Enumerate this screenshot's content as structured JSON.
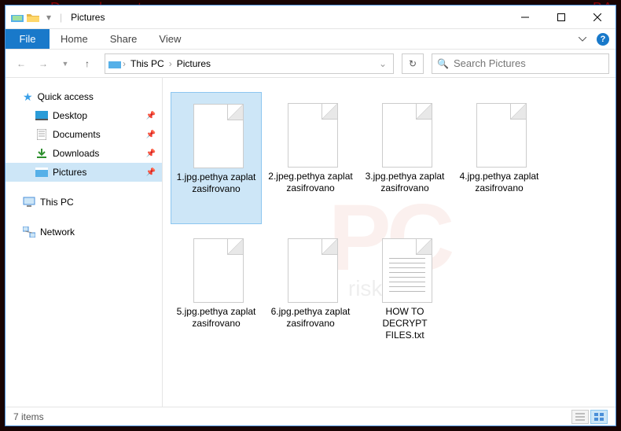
{
  "titlebar": {
    "title": "Pictures"
  },
  "ribbon": {
    "file": "File",
    "home": "Home",
    "share": "Share",
    "view": "View"
  },
  "breadcrumb": {
    "thispc": "This PC",
    "pictures": "Pictures"
  },
  "search": {
    "placeholder": "Search Pictures"
  },
  "sidebar": {
    "quickaccess": "Quick access",
    "desktop": "Desktop",
    "documents": "Documents",
    "downloads": "Downloads",
    "pictures": "Pictures",
    "thispc": "This PC",
    "network": "Network"
  },
  "files": [
    {
      "name": "1.jpg.pethya zaplat zasifrovano",
      "type": "blank",
      "sel": true
    },
    {
      "name": "2.jpeg.pethya zaplat zasifrovano",
      "type": "blank",
      "sel": false
    },
    {
      "name": "3.jpg.pethya zaplat zasifrovano",
      "type": "blank",
      "sel": false
    },
    {
      "name": "4.jpg.pethya zaplat zasifrovano",
      "type": "blank",
      "sel": false
    },
    {
      "name": "5.jpg.pethya zaplat zasifrovano",
      "type": "blank",
      "sel": false
    },
    {
      "name": "6.jpg.pethya zaplat zasifrovano",
      "type": "blank",
      "sel": false
    },
    {
      "name": "HOW TO DECRYPT FILES.txt",
      "type": "txt",
      "sel": false
    }
  ],
  "status": {
    "count": "7 items"
  },
  "watermark": {
    "a": "PC",
    "b": "risk.com"
  }
}
